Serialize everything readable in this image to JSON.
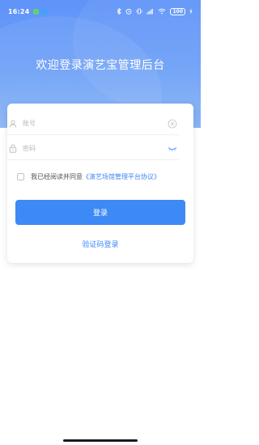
{
  "status_bar": {
    "time": "16:24",
    "battery": "100"
  },
  "page": {
    "title": "欢迎登录演艺宝管理后台"
  },
  "login_form": {
    "account_placeholder": "账号",
    "password_placeholder": "密码",
    "agreement_prefix": "我已经阅读并同意",
    "agreement_link": "《演艺场馆管理平台协议》",
    "login_button": "登录",
    "code_login_link": "验证码登录"
  },
  "colors": {
    "header_gradient_start": "#5f93f8",
    "primary": "#3d8af7",
    "card_bg": "#ffffff"
  },
  "icons": {
    "account": "user-icon",
    "password": "lock-icon",
    "clear": "clear-icon",
    "password_toggle": "eye-closed-icon"
  }
}
